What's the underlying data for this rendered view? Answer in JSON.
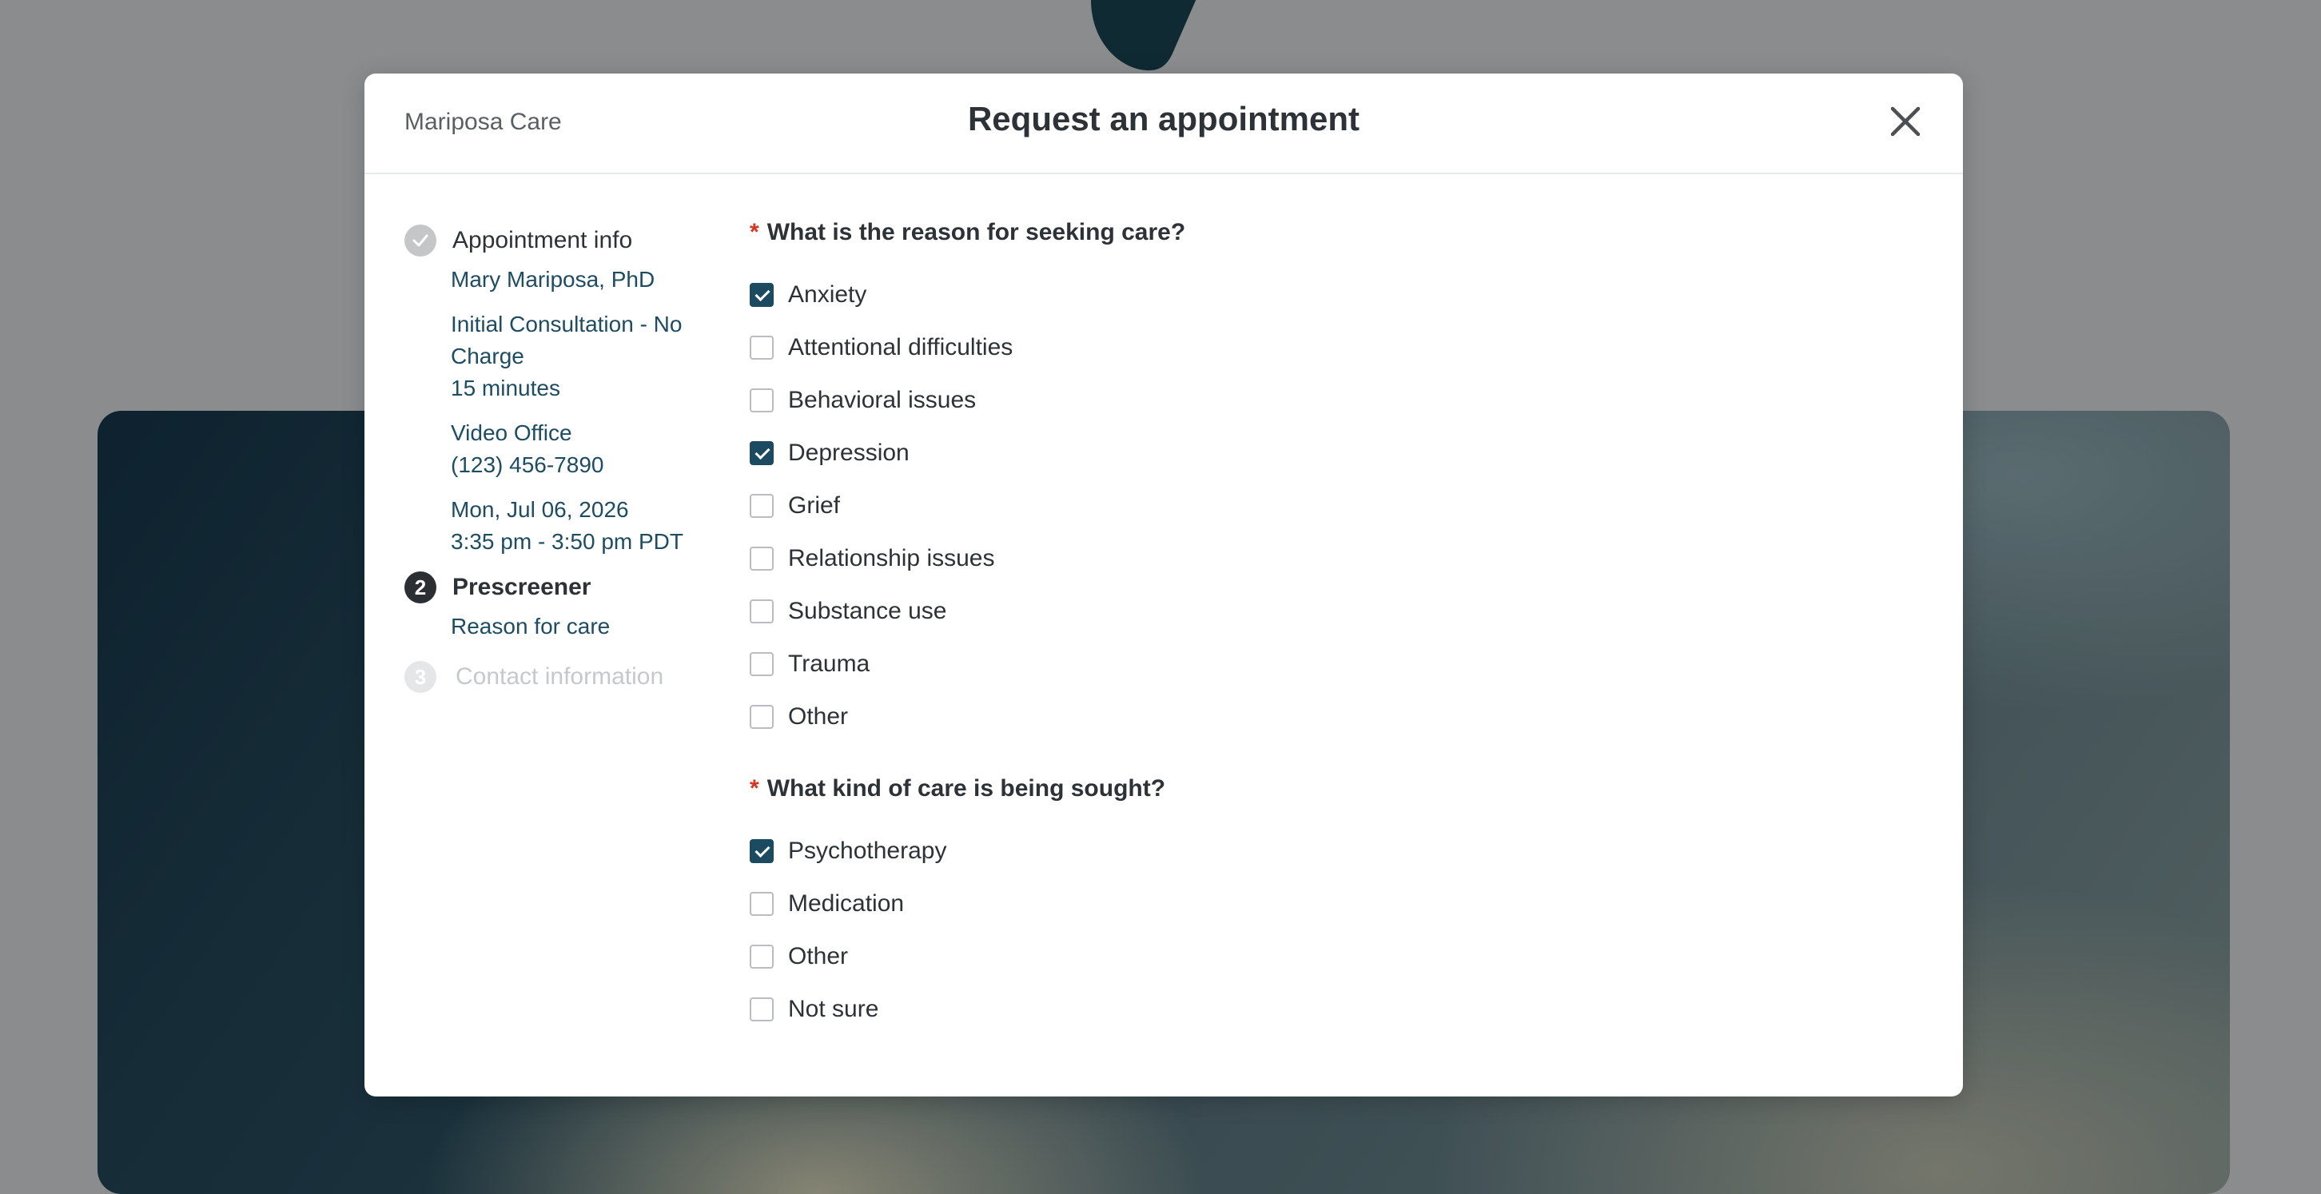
{
  "modal": {
    "brand": "Mariposa Care",
    "title": "Request an appointment"
  },
  "stepper": {
    "step1": {
      "label": "Appointment info",
      "provider": "Mary Mariposa, PhD",
      "service_line1": "Initial Consultation - No",
      "service_line2": "Charge",
      "duration": "15 minutes",
      "location": "Video Office",
      "phone": "(123) 456-7890",
      "date": "Mon, Jul 06, 2026",
      "time": "3:35 pm - 3:50 pm PDT"
    },
    "step2": {
      "number": "2",
      "label": "Prescreener",
      "sub": "Reason for care"
    },
    "step3": {
      "number": "3",
      "label": "Contact information"
    }
  },
  "form": {
    "q1": {
      "required_mark": "*",
      "text": "What is the reason for seeking care?",
      "options": [
        {
          "label": "Anxiety",
          "checked": true
        },
        {
          "label": "Attentional difficulties",
          "checked": false
        },
        {
          "label": "Behavioral issues",
          "checked": false
        },
        {
          "label": "Depression",
          "checked": true
        },
        {
          "label": "Grief",
          "checked": false
        },
        {
          "label": "Relationship issues",
          "checked": false
        },
        {
          "label": "Substance use",
          "checked": false
        },
        {
          "label": "Trauma",
          "checked": false
        },
        {
          "label": "Other",
          "checked": false
        }
      ]
    },
    "q2": {
      "required_mark": "*",
      "text": "What kind of care is being sought?",
      "options": [
        {
          "label": "Psychotherapy",
          "checked": true
        },
        {
          "label": "Medication",
          "checked": false
        },
        {
          "label": "Other",
          "checked": false
        },
        {
          "label": "Not sure",
          "checked": false
        }
      ]
    }
  },
  "colors": {
    "accent": "#1c4a61",
    "link_text": "#1d4c63",
    "required": "#d6341f",
    "backdrop": "#8b8c8e"
  },
  "icons": {
    "close": "close-icon",
    "step_done": "check-icon"
  }
}
